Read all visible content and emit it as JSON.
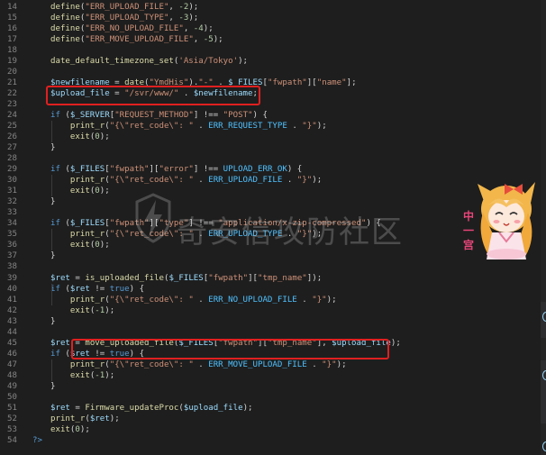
{
  "editor": {
    "lines": [
      {
        "n": "14",
        "t": "define(\"ERR_UPLOAD_FILE\", -2);"
      },
      {
        "n": "15",
        "t": "define(\"ERR_UPLOAD_TYPE\", -3);"
      },
      {
        "n": "16",
        "t": "define(\"ERR_NO_UPLOAD_FILE\", -4);"
      },
      {
        "n": "17",
        "t": "define(\"ERR_MOVE_UPLOAD_FILE\", -5);"
      },
      {
        "n": "18",
        "t": ""
      },
      {
        "n": "19",
        "t": "date_default_timezone_set('Asia/Tokyo');"
      },
      {
        "n": "20",
        "t": ""
      },
      {
        "n": "21",
        "t": "$newfilename = date(\"YmdHis\").\"-\" . $_FILES[\"fwpath\"][\"name\"];"
      },
      {
        "n": "22",
        "t": "$upload_file = \"/svr/www/\" . $newfilename;"
      },
      {
        "n": "23",
        "t": ""
      },
      {
        "n": "24",
        "t": "if ($_SERVER[\"REQUEST_METHOD\"] !== \"POST\") {"
      },
      {
        "n": "25",
        "t": "    print_r(\"{\\\"ret_code\\\": \" . ERR_REQUEST_TYPE . \"}\");"
      },
      {
        "n": "26",
        "t": "    exit(0);"
      },
      {
        "n": "27",
        "t": "}"
      },
      {
        "n": "28",
        "t": ""
      },
      {
        "n": "29",
        "t": "if ($_FILES[\"fwpath\"][\"error\"] !== UPLOAD_ERR_OK) {"
      },
      {
        "n": "30",
        "t": "    print_r(\"{\\\"ret_code\\\": \" . ERR_UPLOAD_FILE . \"}\");"
      },
      {
        "n": "31",
        "t": "    exit(0);"
      },
      {
        "n": "32",
        "t": "}"
      },
      {
        "n": "33",
        "t": ""
      },
      {
        "n": "34",
        "t": "if ($_FILES[\"fwpath\"][\"type\"] !== \"application/x-zip-compressed\") {"
      },
      {
        "n": "35",
        "t": "    print_r(\"{\\\"ret_code\\\": \" . ERR_UPLOAD_TYPE . \"}\");"
      },
      {
        "n": "36",
        "t": "    exit(0);"
      },
      {
        "n": "37",
        "t": "}"
      },
      {
        "n": "38",
        "t": ""
      },
      {
        "n": "39",
        "t": "$ret = is_uploaded_file($_FILES[\"fwpath\"][\"tmp_name\"]);"
      },
      {
        "n": "40",
        "t": "if ($ret != true) {"
      },
      {
        "n": "41",
        "t": "    print_r(\"{\\\"ret_code\\\": \" . ERR_NO_UPLOAD_FILE . \"}\");"
      },
      {
        "n": "42",
        "t": "    exit(-1);"
      },
      {
        "n": "43",
        "t": "}"
      },
      {
        "n": "44",
        "t": ""
      },
      {
        "n": "45",
        "t": "$ret = move_uploaded_file($_FILES[\"fwpath\"][\"tmp_name\"], $upload_file);"
      },
      {
        "n": "46",
        "t": "if ($ret != true) {"
      },
      {
        "n": "47",
        "t": "    print_r(\"{\\\"ret_code\\\": \" . ERR_MOVE_UPLOAD_FILE . \"}\");"
      },
      {
        "n": "48",
        "t": "    exit(-1);"
      },
      {
        "n": "49",
        "t": "}"
      },
      {
        "n": "50",
        "t": ""
      },
      {
        "n": "51",
        "t": "$ret = Firmware_updateProc($upload_file);"
      },
      {
        "n": "52",
        "t": "print_r($ret);"
      },
      {
        "n": "53",
        "t": "exit(0);"
      },
      {
        "n": "54",
        "t": "?>"
      }
    ]
  },
  "watermark": {
    "text": "奇安信攻防社区",
    "logo_icon": "lightning-shield-logo"
  },
  "mascot": {
    "icon": "anime-girl-sticker",
    "caption": "中一宫"
  },
  "colors": {
    "background": "#1e1e1e",
    "keyword": "#569cd6",
    "function": "#dcdcaa",
    "string": "#ce9178",
    "variable": "#9cdcfe",
    "number": "#b5cea8",
    "constant": "#4fc1ff",
    "highlight_box": "#e02020"
  }
}
